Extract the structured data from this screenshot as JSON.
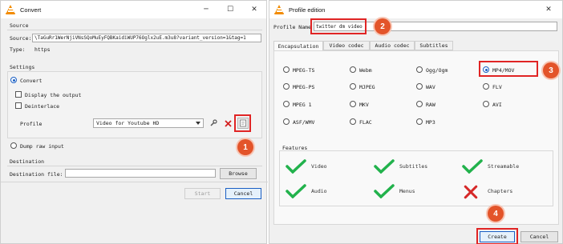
{
  "convert": {
    "title": "Convert",
    "source_section": "Source",
    "source_label": "Source:",
    "source_value": "\\TaGuRr1WerNjiVNsSQoMuEyFQBKaidiWUP76Oglx2uE.m3u8?variant_version=1&tag=1",
    "type_label": "Type:",
    "type_value": "https",
    "settings_section": "Settings",
    "convert_radio": "Convert",
    "display_output": "Display the output",
    "deinterlace": "Deinterlace",
    "profile_label": "Profile",
    "profile_value": "Video for Youtube HD",
    "dump_raw": "Dump raw input",
    "destination_section": "Destination",
    "destination_label": "Destination file:",
    "destination_value": "",
    "browse_label": "Browse",
    "start_label": "Start",
    "cancel_label": "Cancel"
  },
  "profile": {
    "title": "Profile edition",
    "name_label": "Profile Name",
    "name_value": "twitter dm video",
    "tabs": [
      {
        "label": "Encapsulation"
      },
      {
        "label": "Video codec"
      },
      {
        "label": "Audio codec"
      },
      {
        "label": "Subtitles"
      }
    ],
    "formats": [
      {
        "label": "MPEG-TS"
      },
      {
        "label": "Webm"
      },
      {
        "label": "Ogg/Ogm"
      },
      {
        "label": "MP4/MOV"
      },
      {
        "label": "MPEG-PS"
      },
      {
        "label": "MJPEG"
      },
      {
        "label": "WAV"
      },
      {
        "label": "FLV"
      },
      {
        "label": "MPEG 1"
      },
      {
        "label": "MKV"
      },
      {
        "label": "RAW"
      },
      {
        "label": "AVI"
      },
      {
        "label": "ASF/WMV"
      },
      {
        "label": "FLAC"
      },
      {
        "label": "MP3"
      }
    ],
    "selected_format": "MP4/MOV",
    "features_label": "Features",
    "features": [
      {
        "label": "Video",
        "supported": true
      },
      {
        "label": "Subtitles",
        "supported": true
      },
      {
        "label": "Streamable",
        "supported": true
      },
      {
        "label": "Audio",
        "supported": true
      },
      {
        "label": "Menus",
        "supported": true
      },
      {
        "label": "Chapters",
        "supported": false
      }
    ],
    "create_label": "Create",
    "cancel_label": "Cancel"
  },
  "badges": [
    "1",
    "2",
    "3",
    "4"
  ],
  "colors": {
    "accent": "#1a5fc4",
    "check": "#22b24c",
    "cross": "#d62828",
    "highlight": "#e02424",
    "badge": "#e3542a"
  },
  "window_controls": {
    "minimize": "─",
    "maximize": "☐",
    "close": "✕"
  }
}
